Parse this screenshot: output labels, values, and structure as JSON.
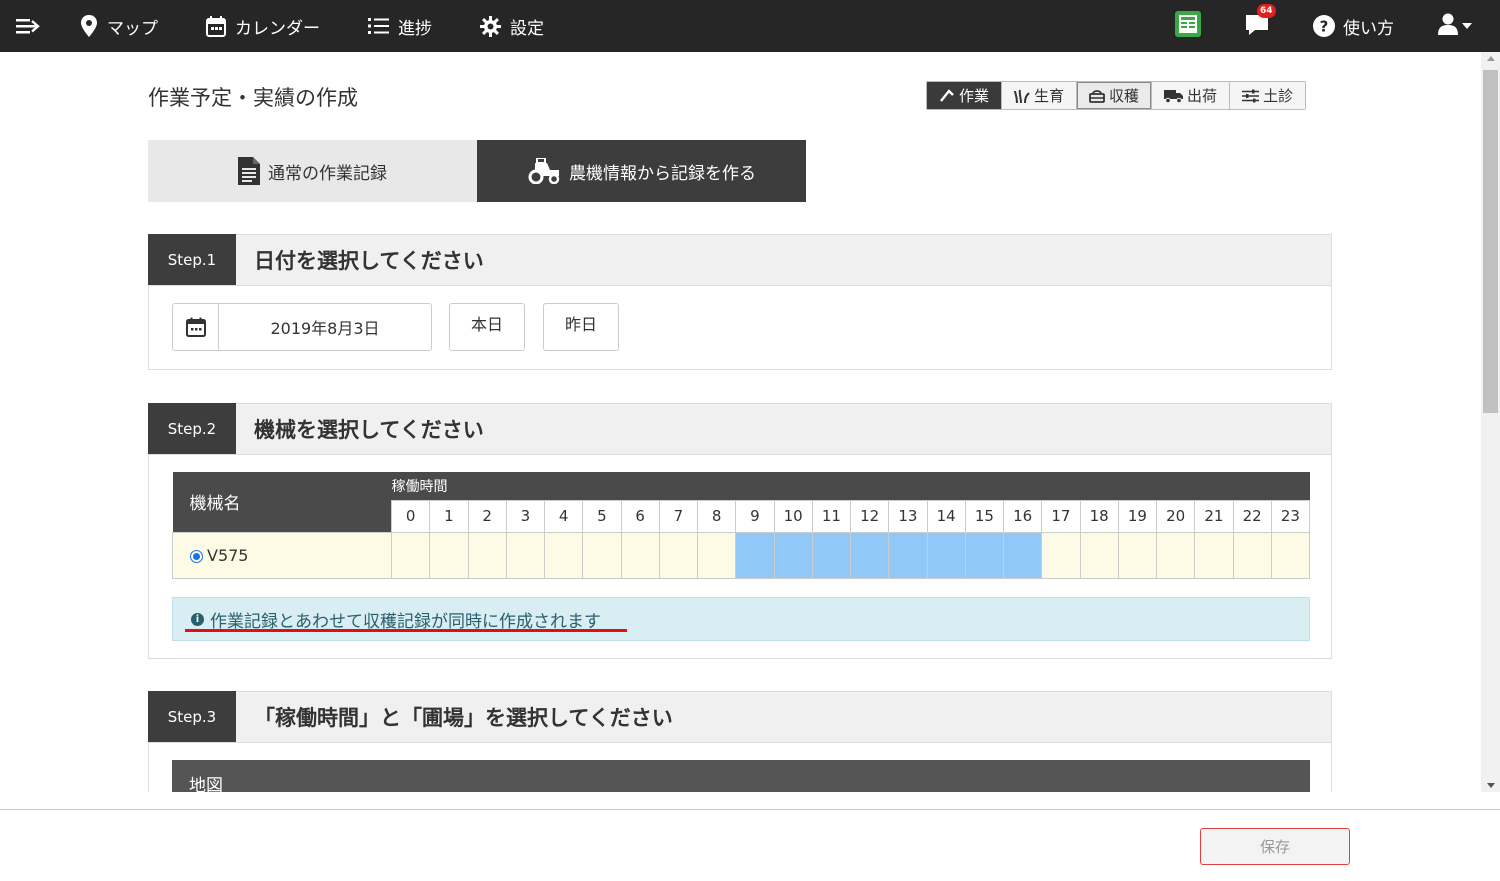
{
  "nav": {
    "items": [
      {
        "label": "マップ",
        "icon": "map-pin-icon"
      },
      {
        "label": "カレンダー",
        "icon": "calendar-icon"
      },
      {
        "label": "進捗",
        "icon": "list-icon"
      },
      {
        "label": "設定",
        "icon": "gear-icon"
      }
    ],
    "notification_count": "64",
    "help_label": "使い方"
  },
  "page": {
    "title": "作業予定・実績の作成"
  },
  "type_tabs": [
    {
      "label": "作業",
      "active": true
    },
    {
      "label": "生育",
      "active": false
    },
    {
      "label": "収穫",
      "active": false
    },
    {
      "label": "出荷",
      "active": false
    },
    {
      "label": "土診",
      "active": false
    }
  ],
  "mode_tabs": {
    "normal": "通常の作業記録",
    "machine": "農機情報から記録を作る"
  },
  "step1": {
    "label": "Step.1",
    "title": "日付を選択してください",
    "date_value": "2019年8月3日",
    "today_label": "本日",
    "yesterday_label": "昨日"
  },
  "step2": {
    "label": "Step.2",
    "title": "機械を選択してください",
    "col_machine": "機械名",
    "col_operating": "稼働時間",
    "hours": [
      "0",
      "1",
      "2",
      "3",
      "4",
      "5",
      "6",
      "7",
      "8",
      "9",
      "10",
      "11",
      "12",
      "13",
      "14",
      "15",
      "16",
      "17",
      "18",
      "19",
      "20",
      "21",
      "22",
      "23"
    ],
    "machine_name": "V575",
    "active_hours_from": 9,
    "active_hours_to": 16,
    "info": "作業記録とあわせて収穫記録が同時に作成されます"
  },
  "step3": {
    "label": "Step.3",
    "title": "「稼働時間」と「圃場」を選択してください",
    "map_label": "地図"
  },
  "footer": {
    "save_label": "保存"
  },
  "colors": {
    "nav_bg": "#262626",
    "active_hour": "#90c8f8",
    "save_border": "#e04040"
  }
}
